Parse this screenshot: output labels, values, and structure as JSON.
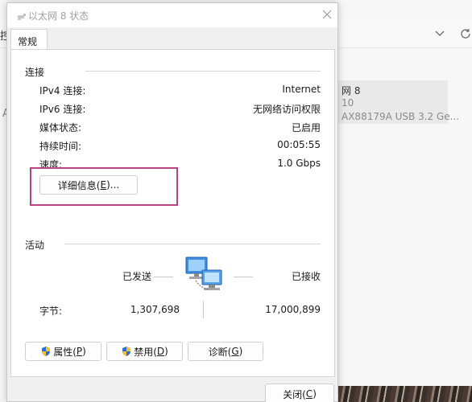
{
  "background": {
    "left_char": "控",
    "side_char": "A",
    "card": {
      "line1": "网 8",
      "line2": "10",
      "line3": "AX88179A USB 3.2 Ge..."
    }
  },
  "dialog": {
    "title": "以太网 8 状态",
    "tab": "常规",
    "connection": {
      "heading": "连接",
      "rows": [
        {
          "label": "IPv4 连接:",
          "value": "Internet"
        },
        {
          "label": "IPv6 连接:",
          "value": "无网络访问权限"
        },
        {
          "label": "媒体状态:",
          "value": "已启用"
        },
        {
          "label": "持续时间:",
          "value": "00:05:55"
        },
        {
          "label": "速度:",
          "value": "1.0 Gbps"
        }
      ],
      "details_button": {
        "text": "详细信息(",
        "key": "E",
        "suffix": ")..."
      }
    },
    "activity": {
      "heading": "活动",
      "sent_label": "已发送",
      "received_label": "已接收",
      "bytes_label": "字节:",
      "bytes_sent": "1,307,698",
      "bytes_received": "17,000,899"
    },
    "buttons": {
      "properties": {
        "text": "属性(",
        "key": "P",
        "suffix": ")"
      },
      "disable": {
        "text": "禁用(",
        "key": "D",
        "suffix": ")"
      },
      "diagnose": {
        "text": "诊断(",
        "key": "G",
        "suffix": ")"
      },
      "close": {
        "text": "关闭(",
        "key": "C",
        "suffix": ")"
      }
    }
  },
  "colors": {
    "highlight": "#b8447f",
    "shield_blue": "#2a6fd6",
    "shield_yellow": "#f2c230"
  }
}
